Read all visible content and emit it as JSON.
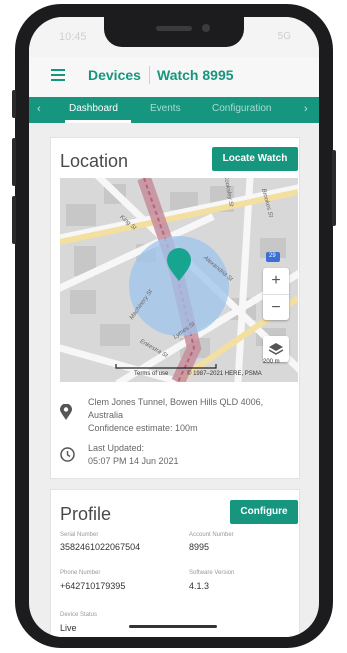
{
  "statusbar": {
    "time": "10:45",
    "icons": "5G"
  },
  "topbar": {
    "section": "Devices",
    "device": "Watch 8995"
  },
  "tabs": {
    "prev_icon": "‹",
    "next_icon": "›",
    "items": [
      "Dashboard",
      "Events",
      "Configuration"
    ],
    "active": "Dashboard"
  },
  "location": {
    "title": "Location",
    "locate_button": "Locate Watch",
    "address_line1": "Clem Jones Tunnel, Bowen Hills QLD 4006,",
    "address_line2": "Australia",
    "confidence": "Confidence estimate: 100m",
    "updated_label": "Last Updated:",
    "updated_value": "05:07 PM 14 Jun 2021",
    "map": {
      "zoom_in": "+",
      "zoom_out": "−",
      "terms": "Terms of use",
      "copyright": "© 1987–2021 HERE, PSMA",
      "scale": "200 m",
      "street_labels": [
        "King St",
        "Alexandria St",
        "Machinery St",
        "Enkestra St",
        "Brookes St",
        "Lymes St",
        "Cooksley St"
      ],
      "route_badge": "29"
    }
  },
  "profile": {
    "title": "Profile",
    "configure_button": "Configure",
    "serial_label": "Serial Number",
    "serial_value": "3582461022067504",
    "account_label": "Account Number",
    "account_value": "8995",
    "phone_label": "Phone Number",
    "phone_value": "+642710179395",
    "software_label": "Software Version",
    "software_value": "4.1.3",
    "status_label": "Device Status",
    "status_value": "Live"
  },
  "colors": {
    "accent": "#17967f",
    "accuracy_circle": "#9fc4ee",
    "pin": "#18a58f"
  }
}
